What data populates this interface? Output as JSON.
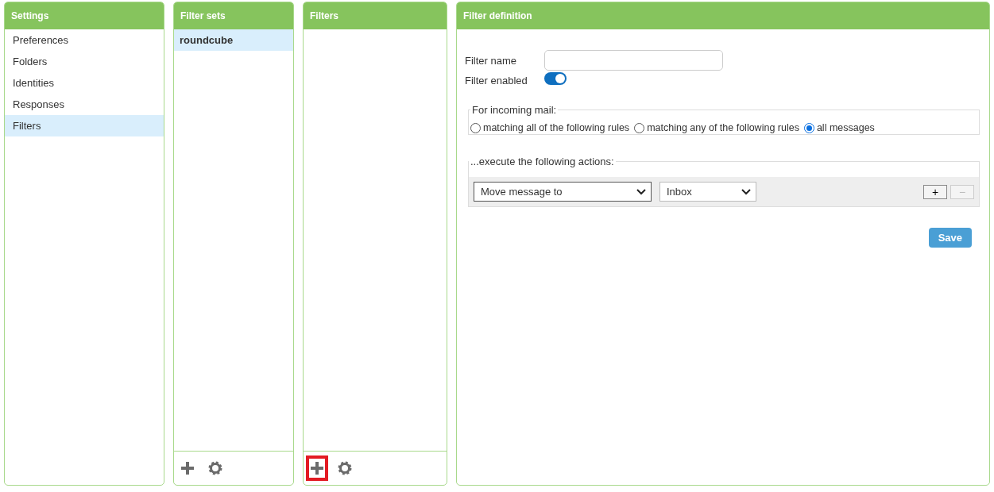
{
  "settings": {
    "title": "Settings",
    "items": [
      {
        "label": "Preferences",
        "selected": false
      },
      {
        "label": "Folders",
        "selected": false
      },
      {
        "label": "Identities",
        "selected": false
      },
      {
        "label": "Responses",
        "selected": false
      },
      {
        "label": "Filters",
        "selected": true
      }
    ]
  },
  "filter_sets": {
    "title": "Filter sets",
    "items": [
      {
        "label": "roundcube",
        "selected": true
      }
    ],
    "add_highlighted": false
  },
  "filters": {
    "title": "Filters",
    "add_highlighted": true
  },
  "definition": {
    "title": "Filter definition",
    "name_label": "Filter name",
    "enabled_label": "Filter enabled",
    "enabled": true,
    "incoming_legend": "For incoming mail:",
    "match_options": [
      {
        "label": "matching all of the following rules",
        "selected": false
      },
      {
        "label": "matching any of the following rules",
        "selected": false
      },
      {
        "label": "all messages",
        "selected": true
      }
    ],
    "actions_legend": "...execute the following actions:",
    "action": {
      "type": "Move message to",
      "folder": "Inbox",
      "add": "+",
      "remove": "−",
      "remove_disabled": true
    },
    "save": "Save"
  }
}
